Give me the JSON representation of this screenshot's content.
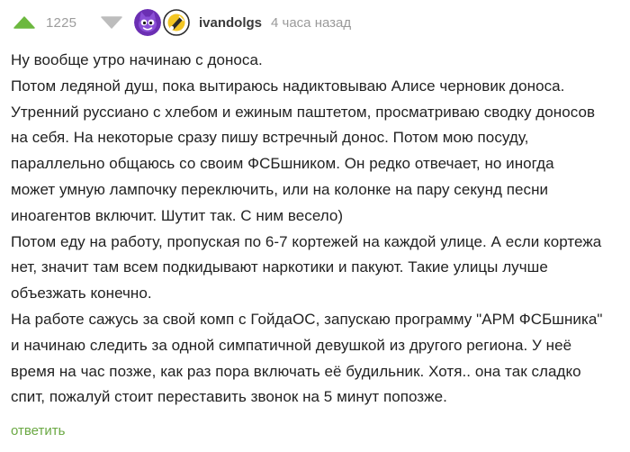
{
  "comment": {
    "rating": "1225",
    "author": {
      "username": "ivandolgs",
      "avatar_icons": [
        "purple-cat-avatar-icon",
        "award-badge-icon"
      ]
    },
    "timestamp": "4 часа назад",
    "body_lines": [
      "Ну вообще утро начинаю с доноса.",
      "Потом ледяной душ, пока вытираюсь надиктовываю Алисе черновик доноса.",
      "Утренний руссиано с хлебом и ежиным паштетом, просматриваю сводку доносов",
      "на себя. На некоторые сразу пишу встречный донос. Потом мою посуду,",
      "параллельно общаюсь со своим ФСБшником. Он редко отвечает, но иногда",
      "может умную лампочку переключить, или на колонке на пару секунд песни",
      "иноагентов включит. Шутит так. С ним весело)",
      "Потом еду на работу, пропуская по 6-7 кортежей на каждой улице. А если кортежа",
      "нет, значит там всем подкидывают наркотики и пакуют. Такие улицы лучше",
      "объезжать конечно.",
      "На работе сажусь за свой комп с ГойдаОС, запускаю программу \"АРМ ФСБшника\"",
      "и начинаю следить за одной симпатичной девушкой из другого региона. У неё",
      "время на час позже, как раз пора включать её будильник. Хотя.. она так сладко",
      "спит, пожалуй стоит переставить звонок на 5 минут попозже."
    ],
    "reply_label": "ответить"
  },
  "colors": {
    "upvote": "#6cb83f",
    "downvote": "#bdbdbd",
    "reply_link": "#6aa843",
    "muted_text": "#9a9a9a"
  },
  "icons": {
    "upvote": "triangle-up-icon",
    "downvote": "triangle-down-icon"
  }
}
